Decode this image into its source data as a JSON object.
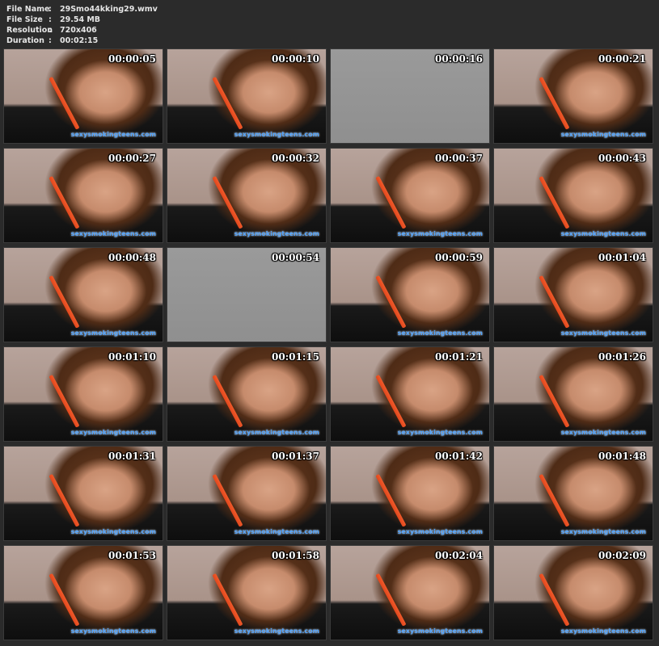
{
  "info": [
    {
      "label": "File Name",
      "value": "29Smo44kking29.wmv"
    },
    {
      "label": "File Size",
      "value": "29.54 MB"
    },
    {
      "label": "Resolution",
      "value": "720x406"
    },
    {
      "label": "Duration",
      "value": "00:02:15"
    }
  ],
  "separator": ":",
  "watermark": "sexysmokingteens.com",
  "thumbs": [
    {
      "ts": "00:00:05",
      "grey": false
    },
    {
      "ts": "00:00:10",
      "grey": false
    },
    {
      "ts": "00:00:16",
      "grey": true
    },
    {
      "ts": "00:00:21",
      "grey": false
    },
    {
      "ts": "00:00:27",
      "grey": false
    },
    {
      "ts": "00:00:32",
      "grey": false
    },
    {
      "ts": "00:00:37",
      "grey": false
    },
    {
      "ts": "00:00:43",
      "grey": false
    },
    {
      "ts": "00:00:48",
      "grey": false
    },
    {
      "ts": "00:00:54",
      "grey": true
    },
    {
      "ts": "00:00:59",
      "grey": false
    },
    {
      "ts": "00:01:04",
      "grey": false
    },
    {
      "ts": "00:01:10",
      "grey": false
    },
    {
      "ts": "00:01:15",
      "grey": false
    },
    {
      "ts": "00:01:21",
      "grey": false
    },
    {
      "ts": "00:01:26",
      "grey": false
    },
    {
      "ts": "00:01:31",
      "grey": false
    },
    {
      "ts": "00:01:37",
      "grey": false
    },
    {
      "ts": "00:01:42",
      "grey": false
    },
    {
      "ts": "00:01:48",
      "grey": false
    },
    {
      "ts": "00:01:53",
      "grey": false
    },
    {
      "ts": "00:01:58",
      "grey": false
    },
    {
      "ts": "00:02:04",
      "grey": false
    },
    {
      "ts": "00:02:09",
      "grey": false
    }
  ]
}
